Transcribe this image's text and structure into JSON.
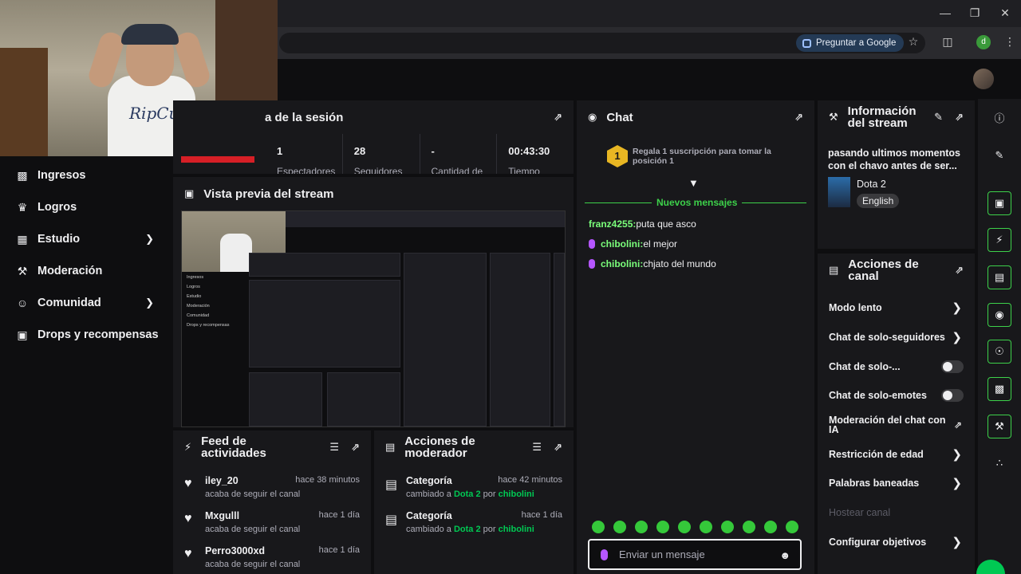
{
  "browser": {
    "ask_google": "Preguntar a Google",
    "profile_initial": "d"
  },
  "sidebar": {
    "items": [
      {
        "label": "Ingresos",
        "icon": "bar-chart-icon"
      },
      {
        "label": "Logros",
        "icon": "trophy-icon"
      },
      {
        "label": "Estudio",
        "icon": "grid-icon"
      },
      {
        "label": "Moderación",
        "icon": "wrench-icon"
      },
      {
        "label": "Comunidad",
        "icon": "community-icon"
      },
      {
        "label": "Drops y recompensas",
        "icon": "gift-icon"
      }
    ]
  },
  "session": {
    "title": "a de la sesión",
    "stats": [
      {
        "value": "1",
        "label": "Espectadores"
      },
      {
        "value": "28",
        "label": "Seguidores"
      },
      {
        "value": "-",
        "label": "Cantidad de"
      },
      {
        "value": "00:43:30",
        "label": "Tiempo"
      }
    ]
  },
  "preview": {
    "title": "Vista previa del stream"
  },
  "feed": {
    "title_line1": "Feed de",
    "title_line2": "actividades",
    "items": [
      {
        "name": "iley_20",
        "sub": "acaba de seguir el canal",
        "time": "hace 38 minutos"
      },
      {
        "name": "Mxgulll",
        "sub": "acaba de seguir el canal",
        "time": "hace 1 día"
      },
      {
        "name": "Perro3000xd",
        "sub": "acaba de seguir el canal",
        "time": "hace 1 día"
      }
    ]
  },
  "mod_actions": {
    "title_line1": "Acciones de",
    "title_line2": "moderador",
    "items": [
      {
        "name": "Categoría",
        "prefix": "cambiado a ",
        "game": "Dota 2",
        "by": " por ",
        "user": "chibolini",
        "time": "hace 42 minutos"
      },
      {
        "name": "Categoría",
        "prefix": "cambiado a ",
        "game": "Dota 2",
        "by": " por ",
        "user": "chibolini",
        "time": "hace 1 día"
      }
    ]
  },
  "chat": {
    "title": "Chat",
    "gift_rank": "1",
    "gift_text": "Regala 1 suscripción para tomar la posición 1",
    "new_messages": "Nuevos mensajes",
    "messages": [
      {
        "user": "franz4255",
        "text": " puta que asco",
        "badge": false
      },
      {
        "user": "chibolini",
        "text": " el mejor",
        "badge": true
      },
      {
        "user": "chibolini",
        "text": " chjato del mundo",
        "badge": true
      }
    ],
    "placeholder": "Enviar un mensaje"
  },
  "stream_info": {
    "title_line1": "Información",
    "title_line2": "del stream",
    "stream_title": "pasando ultimos momentos con el chavo antes de ser...",
    "category": "Dota 2",
    "language": "English"
  },
  "channel_actions": {
    "title_line1": "Acciones de",
    "title_line2": "canal",
    "items": [
      {
        "label": "Modo lento",
        "control": "chevron"
      },
      {
        "label": "Chat de solo-seguidores",
        "control": "chevron"
      },
      {
        "label": "Chat de solo-...",
        "control": "toggle"
      },
      {
        "label": "Chat de solo-emotes",
        "control": "toggle"
      },
      {
        "label": "Moderación del chat con IA",
        "control": "external"
      },
      {
        "label": "Restricción de edad",
        "control": "chevron"
      },
      {
        "label": "Palabras baneadas",
        "control": "chevron"
      },
      {
        "label": "Hostear canal",
        "control": "none"
      },
      {
        "label": "Configurar objetivos",
        "control": "chevron"
      }
    ]
  },
  "colors": {
    "accent_green": "#00c853",
    "chat_mic_purple": "#b556ff",
    "gift_gold": "#e8b623",
    "background": "#0e0e10",
    "panel": "#18181b"
  }
}
